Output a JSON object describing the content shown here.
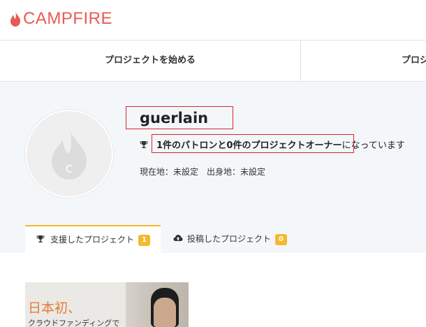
{
  "header": {
    "logo_text": "CAMPFIRE"
  },
  "nav": {
    "items": [
      {
        "label": "プロジェクトを始める"
      },
      {
        "label": "プロジ"
      }
    ]
  },
  "profile": {
    "avatar_initial": "C",
    "username": "guerlain",
    "stats": {
      "count_part": "1件のパトロンと0件のプロジェクトオーナー",
      "suffix": "になっています"
    },
    "location": "現在地：未設定　出身地：未設定"
  },
  "tabs": [
    {
      "label": "支援したプロジェクト",
      "count": "1",
      "icon": "trophy-icon"
    },
    {
      "label": "投稿したプロジェクト",
      "count": "0",
      "icon": "cloud-upload-icon"
    }
  ],
  "card": {
    "title": "日本初、",
    "subtitle": "クラウドファンディングで"
  },
  "colors": {
    "brand": "#e85a53",
    "accent": "#f5b82e",
    "highlight": "#d9232e"
  }
}
